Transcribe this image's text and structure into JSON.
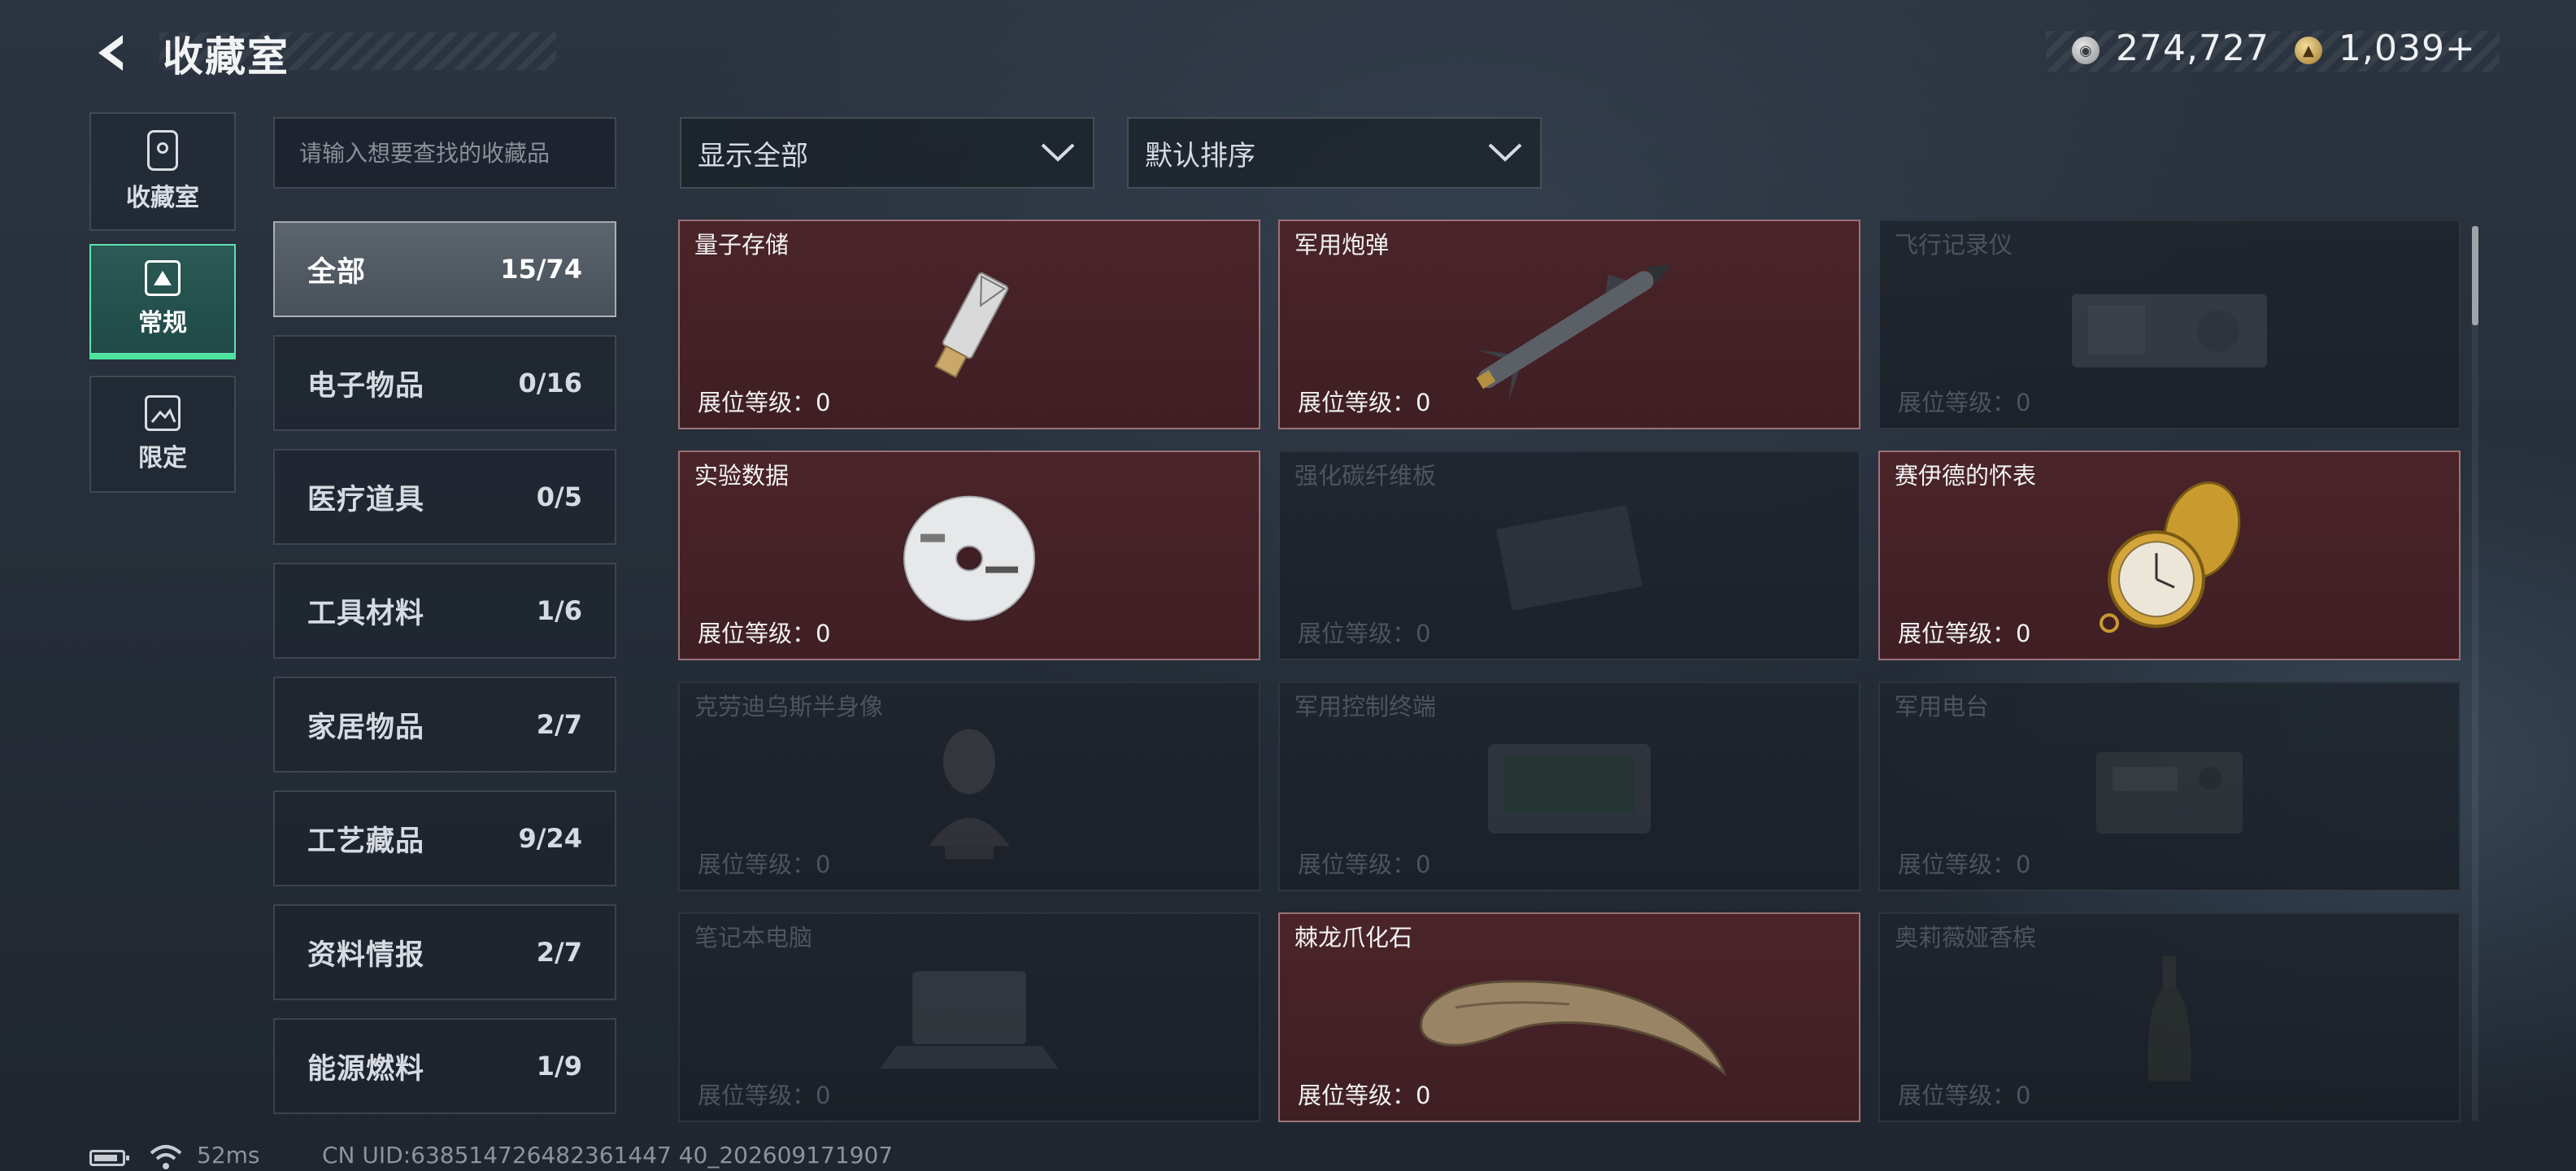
{
  "header": {
    "title": "收藏室",
    "currencies": [
      {
        "name": "silver-coin",
        "value": "274,727"
      },
      {
        "name": "gold-coin",
        "value": "1,039+"
      }
    ]
  },
  "rail": {
    "tabs": [
      {
        "label": "收藏室",
        "icon": "display-case-icon",
        "active": false
      },
      {
        "label": "常规",
        "icon": "collection-card-icon",
        "active": true
      },
      {
        "label": "限定",
        "icon": "limited-image-icon",
        "active": false
      }
    ]
  },
  "search": {
    "placeholder": "请输入想要查找的收藏品",
    "value": ""
  },
  "categories": [
    {
      "name": "全部",
      "count": "15/74",
      "active": true
    },
    {
      "name": "电子物品",
      "count": "0/16",
      "active": false
    },
    {
      "name": "医疗道具",
      "count": "0/5",
      "active": false
    },
    {
      "name": "工具材料",
      "count": "1/6",
      "active": false
    },
    {
      "name": "家居物品",
      "count": "2/7",
      "active": false
    },
    {
      "name": "工艺藏品",
      "count": "9/24",
      "active": false
    },
    {
      "name": "资料情报",
      "count": "2/7",
      "active": false
    },
    {
      "name": "能源燃料",
      "count": "1/9",
      "active": false
    }
  ],
  "filters": {
    "show": "显示全部",
    "sort": "默认排序"
  },
  "items": [
    {
      "name": "量子存储",
      "level": "展位等级：0",
      "owned": true,
      "icon": "usb-drive-icon"
    },
    {
      "name": "军用炮弹",
      "level": "展位等级：0",
      "owned": true,
      "icon": "missile-icon"
    },
    {
      "name": "飞行记录仪",
      "level": "展位等级：0",
      "owned": false,
      "icon": "flight-recorder-icon"
    },
    {
      "name": "实验数据",
      "level": "展位等级：0",
      "owned": true,
      "icon": "disc-icon"
    },
    {
      "name": "强化碳纤维板",
      "level": "展位等级：0",
      "owned": false,
      "icon": "carbon-plate-icon"
    },
    {
      "name": "赛伊德的怀表",
      "level": "展位等级：0",
      "owned": true,
      "icon": "pocket-watch-icon"
    },
    {
      "name": "克劳迪乌斯半身像",
      "level": "展位等级：0",
      "owned": false,
      "icon": "bust-icon"
    },
    {
      "name": "军用控制终端",
      "level": "展位等级：0",
      "owned": false,
      "icon": "control-terminal-icon"
    },
    {
      "name": "军用电台",
      "level": "展位等级：0",
      "owned": false,
      "icon": "radio-icon"
    },
    {
      "name": "笔记本电脑",
      "level": "展位等级：0",
      "owned": false,
      "icon": "laptop-icon"
    },
    {
      "name": "棘龙爪化石",
      "level": "展位等级：0",
      "owned": true,
      "icon": "claw-fossil-icon"
    },
    {
      "name": "奥莉薇娅香槟",
      "level": "展位等级：0",
      "owned": false,
      "icon": "champagne-icon"
    }
  ],
  "status": {
    "ping": "52ms",
    "uid": "CN UID:638514726482361447 40_202609171907"
  },
  "colors": {
    "owned_card": "#46222a",
    "active_tab": "#2c5a55",
    "active_tab_underline": "#49e39c"
  }
}
